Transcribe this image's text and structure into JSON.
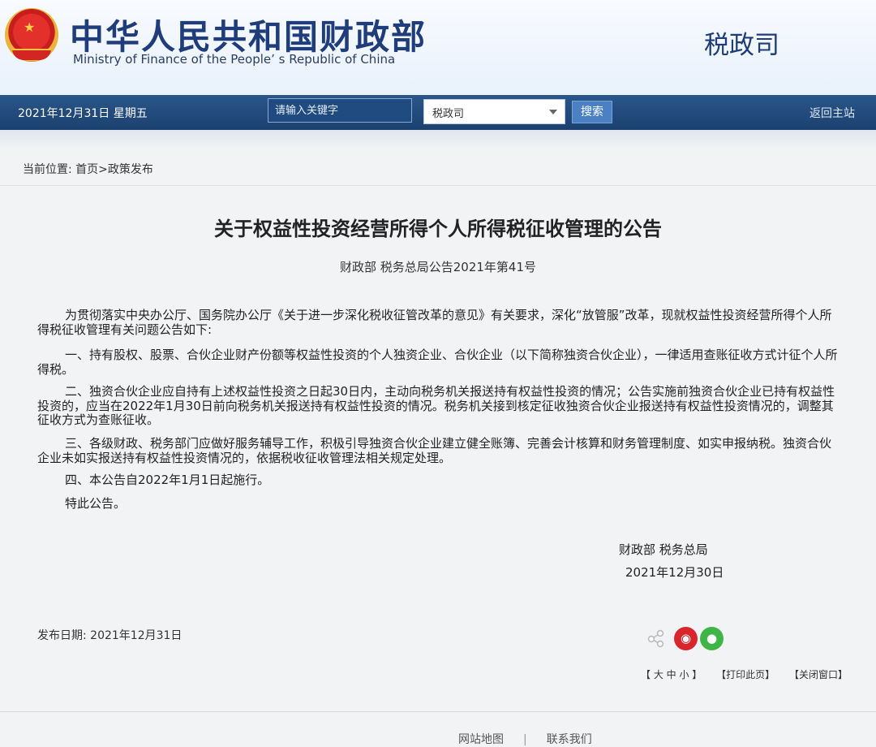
{
  "header": {
    "ministry_cn": "中华人民共和国财政部",
    "ministry_en": "Ministry of Finance of the People’ s Republic of China",
    "department": "税政司"
  },
  "navbar": {
    "date": "2021年12月31日  星期五",
    "search_placeholder": "请输入关键字",
    "select_value": "税政司",
    "search_button": "搜索",
    "home_link": "返回主站"
  },
  "breadcrumb": "当前位置:  首页>政策发布",
  "article": {
    "title": "关于权益性投资经营所得个人所得税征收管理的公告",
    "doc_number": "财政部 税务总局公告2021年第41号",
    "paragraphs": [
      "为贯彻落实中央办公厅、国务院办公厅《关于进一步深化税收征管改革的意见》有关要求，深化“放管服”改革，现就权益性投资经营所得个人所得税征收管理有关问题公告如下:",
      "一、持有股权、股票、合伙企业财产份额等权益性投资的个人独资企业、合伙企业（以下简称独资合伙企业），一律适用查账征收方式计征个人所得税。",
      "二、独资合伙企业应自持有上述权益性投资之日起30日内，主动向税务机关报送持有权益性投资的情况；公告实施前独资合伙企业已持有权益性投资的，应当在2022年1月30日前向税务机关报送持有权益性投资的情况。税务机关接到核定征收独资合伙企业报送持有权益性投资情况的，调整其征收方式为查账征收。",
      "三、各级财政、税务部门应做好服务辅导工作，积极引导独资合伙企业建立健全账簿、完善会计核算和财务管理制度、如实申报纳税。独资合伙企业未如实报送持有权益性投资情况的，依据税收征收管理法相关规定处理。",
      "四、本公告自2022年1月1日起施行。",
      "特此公告。"
    ],
    "signature": "财政部    税务总局",
    "signature_date": "2021年12月30日",
    "publish_date": "发布日期:  2021年12月31日"
  },
  "share": {
    "icons": [
      "share-icon",
      "weibo-icon",
      "wechat-icon"
    ],
    "colors": {
      "weibo": "#d9262b",
      "wechat": "#3fb548"
    }
  },
  "bottom_links": {
    "font_size": "【 大 中 小 】",
    "print": "【打印此页】",
    "close": "【关闭窗口】"
  },
  "footer": {
    "site_map": "网站地图",
    "contact": "联系我们"
  },
  "colors": {
    "navbar": "#1b416f",
    "title_blue": "#1f3d7a",
    "button": "#4b80c2"
  }
}
